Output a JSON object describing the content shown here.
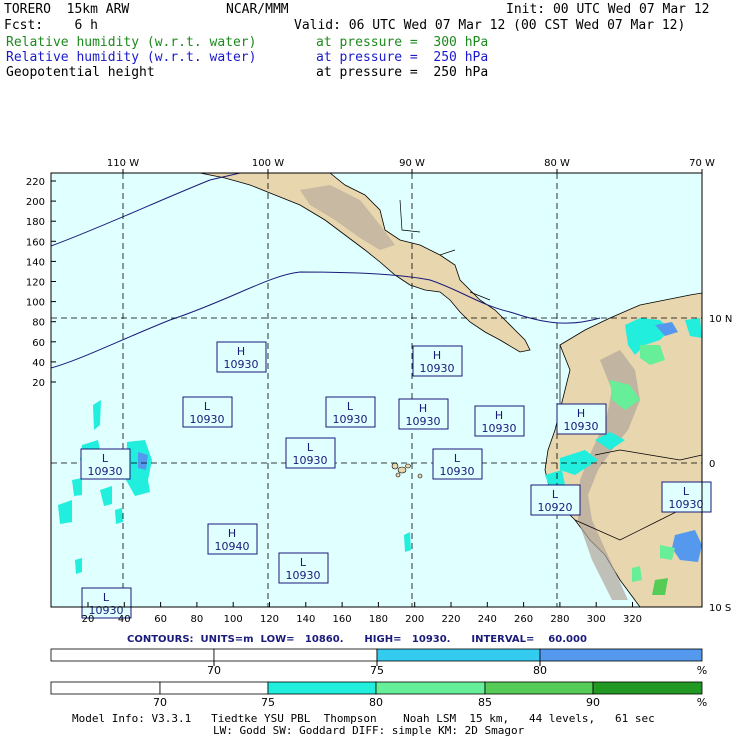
{
  "header": {
    "model": "TORERO  15km ARW",
    "org": "NCAR/MMM",
    "init": "Init: 00 UTC Wed 07 Mar 12",
    "fcst": "Fcst:    6 h",
    "valid": "Valid: 06 UTC Wed 07 Mar 12 (00 CST Wed 07 Mar 12)",
    "fields": [
      {
        "name": "Relative humidity (w.r.t. water)",
        "level": "at pressure =  300 hPa",
        "color": "#1c8a1c"
      },
      {
        "name": "Relative humidity (w.r.t. water)",
        "level": "at pressure =  250 hPa",
        "color": "#1a1acc"
      },
      {
        "name": "Geopotential height",
        "level": "at pressure =  250 hPa",
        "color": "#000000"
      }
    ]
  },
  "map": {
    "top_lon_labels": [
      "110 W",
      "100 W",
      "90 W",
      "80 W",
      "70 W"
    ],
    "right_lat_labels": [
      "10 N",
      "0",
      "10 S"
    ],
    "y_ticks": [
      "220",
      "200",
      "180",
      "160",
      "140",
      "120",
      "100",
      "80",
      "60",
      "40",
      "20"
    ],
    "x_ticks": [
      "20",
      "40",
      "60",
      "80",
      "100",
      "120",
      "140",
      "160",
      "180",
      "200",
      "220",
      "240",
      "260",
      "280",
      "300",
      "320"
    ],
    "ocean_color": "#e0ffff",
    "land_color": "#e8d6ae",
    "highs_lows": [
      {
        "type": "H",
        "value": "10930"
      },
      {
        "type": "H",
        "value": "10930"
      },
      {
        "type": "L",
        "value": "10930"
      },
      {
        "type": "L",
        "value": "10930"
      },
      {
        "type": "H",
        "value": "10930"
      },
      {
        "type": "H",
        "value": "10930"
      },
      {
        "type": "H",
        "value": "10930"
      },
      {
        "type": "L",
        "value": "10930"
      },
      {
        "type": "L",
        "value": "10930"
      },
      {
        "type": "L",
        "value": "10930"
      },
      {
        "type": "L",
        "value": "10930"
      },
      {
        "type": "L",
        "value": "10920"
      },
      {
        "type": "H",
        "value": "10940"
      },
      {
        "type": "L",
        "value": "10930"
      },
      {
        "type": "L",
        "value": "10930"
      },
      {
        "type": "L",
        "value": "10930"
      }
    ]
  },
  "contours": {
    "label": "CONTOURS:",
    "units": "UNITS=m",
    "low": "LOW=   10860.",
    "high": "HIGH=   10930.",
    "interval": "INTERVAL=    60.000"
  },
  "colorbar1": {
    "labels": [
      "70",
      "75",
      "80",
      "%"
    ],
    "colors": [
      "#ffffff",
      "#ffffff",
      "#33ccee",
      "#5599ee"
    ]
  },
  "colorbar2": {
    "labels": [
      "70",
      "75",
      "80",
      "85",
      "90",
      "%"
    ],
    "colors": [
      "#ffffff",
      "#ffffff",
      "#22eedd",
      "#66ee99",
      "#55cc55",
      "#229922"
    ]
  },
  "footer": {
    "line1": "Model Info: V3.3.1   Tiedtke YSU PBL  Thompson    Noah LSM  15 km,   44 levels,   61 sec",
    "line2": "LW: Godd SW: Goddard DIFF: simple KM: 2D Smagor"
  }
}
